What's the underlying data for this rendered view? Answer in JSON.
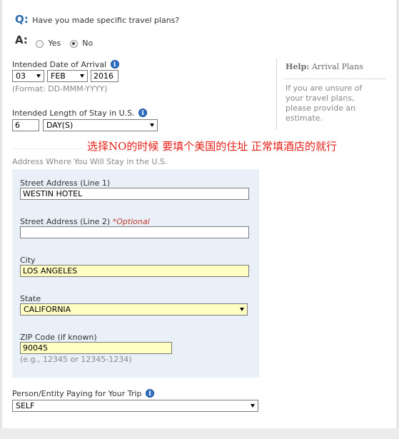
{
  "question": {
    "q_letter": "Q:",
    "text": "Have you made specific travel plans?",
    "a_letter": "A:",
    "options": [
      "Yes",
      "No"
    ],
    "selected": "No"
  },
  "arrival": {
    "label": "Intended Date of Arrival",
    "day": "03",
    "month": "FEB",
    "year": "2016",
    "format_hint": "(Format: DD-MMM-YYYY)"
  },
  "stay": {
    "label": "Intended Length of Stay in U.S.",
    "value": "6",
    "unit": "DAY(S)"
  },
  "help": {
    "title_bold": "Help:",
    "title_rest": " Arrival Plans",
    "text": "If you are unsure of your travel plans, please provide an estimate."
  },
  "annotation": "选择NO的时候  要填个美国的住址  正常填酒店的就行",
  "address": {
    "section_label": "Address Where You Will Stay in the U.S.",
    "street1_label": "Street Address (Line 1)",
    "street1_value": "WESTIN HOTEL",
    "street2_label": "Street Address (Line 2)",
    "street2_optional": "*Optional",
    "street2_value": "",
    "city_label": "City",
    "city_value": "LOS ANGELES",
    "state_label": "State",
    "state_value": "CALIFORNIA",
    "zip_label": "ZIP Code (if known)",
    "zip_value": "90045",
    "zip_hint": "(e.g., 12345 or 12345-1234)"
  },
  "payer": {
    "label": "Person/Entity Paying for Your Trip",
    "value": "SELF"
  },
  "icons": {
    "info": "info-icon",
    "info_glyph": "i"
  }
}
